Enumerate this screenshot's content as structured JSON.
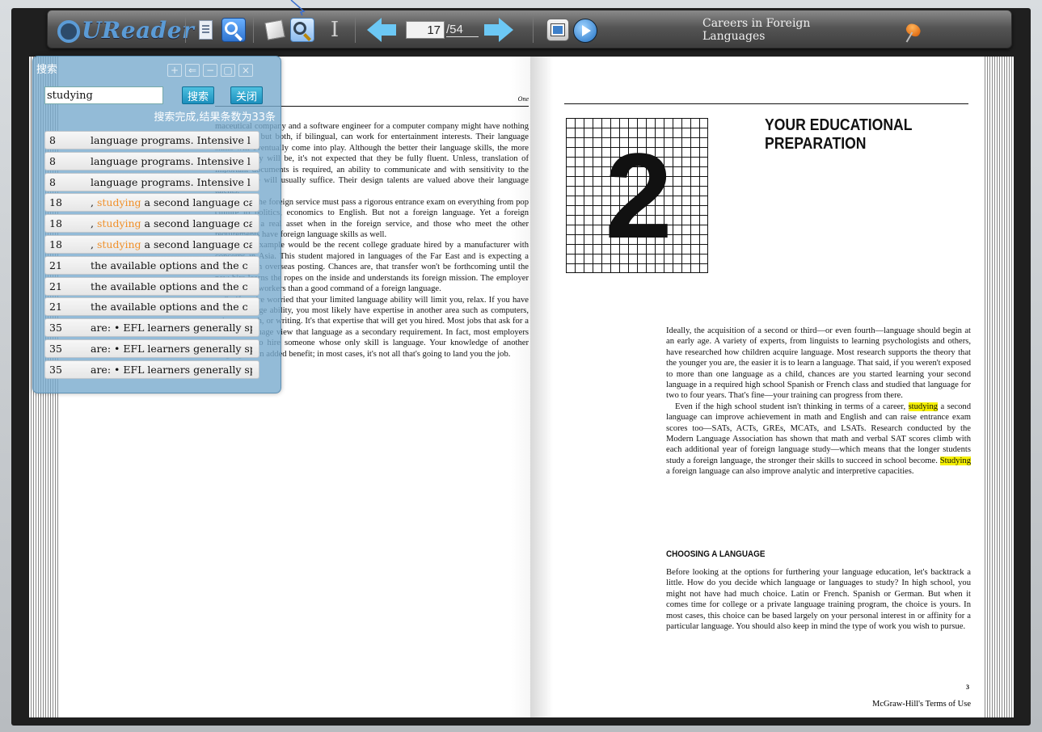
{
  "toolbar": {
    "logo": "UReader",
    "page_current": "17",
    "page_total": "/54",
    "book_title": "Careers in Foreign Languages",
    "icons": [
      "page-view-icon",
      "search-icon",
      "annotate-icon",
      "find-icon",
      "text-select-icon",
      "prev-page-icon",
      "next-page-icon",
      "screenshot-icon",
      "play-icon",
      "pin-icon"
    ]
  },
  "search": {
    "title": "搜索",
    "win_buttons": [
      "+",
      "−",
      "▢",
      "×"
    ],
    "query": "studying",
    "search_button": "搜索",
    "close_button": "关闭",
    "status": "搜索完成,结果条数为33条",
    "keyword_color": "#f0902a",
    "results": [
      {
        "page": "8",
        "pre": "language programs. Intensive l",
        "kw": "",
        "post": ""
      },
      {
        "page": "8",
        "pre": "language programs. Intensive l",
        "kw": "",
        "post": ""
      },
      {
        "page": "8",
        "pre": "language programs. Intensive l",
        "kw": "",
        "post": ""
      },
      {
        "page": "18",
        "pre": ", ",
        "kw": "studying",
        "post": " a second language ca"
      },
      {
        "page": "18",
        "pre": ", ",
        "kw": "studying",
        "post": " a second language ca"
      },
      {
        "page": "18",
        "pre": ", ",
        "kw": "studying",
        "post": " a second language ca"
      },
      {
        "page": "21",
        "pre": "the available options and the c",
        "kw": "",
        "post": ""
      },
      {
        "page": "21",
        "pre": "the available options and the c",
        "kw": "",
        "post": ""
      },
      {
        "page": "21",
        "pre": "the available options and the c",
        "kw": "",
        "post": ""
      },
      {
        "page": "35",
        "pre": "are: • EFL learners generally sp",
        "kw": "",
        "post": ""
      },
      {
        "page": "35",
        "pre": "are: • EFL learners generally sp",
        "kw": "",
        "post": ""
      },
      {
        "page": "35",
        "pre": "are: • EFL learners generally sp",
        "kw": "",
        "post": ""
      }
    ]
  },
  "left_page": {
    "header": "One",
    "paragraphs": [
      "maceutical company and a software engineer for a computer company might have nothing in common, but both, if bilingual, can work for entertainment interests. Their language skills will eventually come into play. Although the better their language skills, the more effective they will be, it's not expected that they be fully fluent. Unless, translation of important documents is required, an ability to communicate and with sensitivity to the other culture will usually suffice. Their design talents are valued above their language talents.",
      "Those in the foreign service must pass a rigorous entrance exam on everything from pop culture to politics, economics to English. But not a foreign language. Yet a foreign language is a real asset when in the foreign service, and those who meet the other requirements have foreign language skills as well.",
      "Another example would be the recent college graduate hired by a manufacturer with concerns in Asia. This student majored in languages of the Far East and is expecting a transfer to an overseas posting. Chances are, that transfer won't be forthcoming until the new hire learns the ropes on the inside and understands its foreign mission. The employer values good workers than a good command of a foreign language.",
      "So if you're worried that your limited language ability will limit you, relax. If you have some language ability, you most likely have expertise in another area such as computers, science, math, or writing. It's that expertise that will get you hired. Most jobs that ask for a foreign language view that language as a secondary requirement. In fact, most employers don't want to hire someone whose only skill is language. Your knowledge of another language is an added benefit; in most cases, it's not all that's going to land you the job."
    ]
  },
  "right_page": {
    "chapter_number": "2",
    "chapter_title": "YOUR EDUCATIONAL PREPARATION",
    "p1": "Ideally, the acquisition of a second or third—or even fourth—language should begin at an early age. A variety of experts, from linguists to learning psychologists and others, have researched how children acquire language. Most research supports the theory that the younger you are, the easier it is to learn a language. That said, if you weren't exposed to more than one language as a child, chances are you started learning your second language in a required high school Spanish or French class and studied that language for two to four years. That's fine—your training can progress from there.",
    "p2_a": "Even if the high school student isn't thinking in terms of a career, ",
    "p2_hl1": "studying",
    "p2_b": " a second language can improve achievement in math and English and can raise entrance exam scores too—SATs, ACTs, GREs, MCATs, and LSATs. Research conducted by the Modern Language Association has shown that math and verbal SAT scores climb with each additional year of foreign language study—which means that the longer students study a foreign language, the stronger their skills to succeed in school become. ",
    "p2_hl2": "Studying",
    "p2_c": " a foreign language can also improve analytic and interpretive capacities.",
    "subheading": "CHOOSING A LANGUAGE",
    "p3": "Before looking at the options for furthering your language education, let's backtrack a little. How do you decide which language or languages to study? In high school, you might not have had much choice. Latin or French. Spanish or German. But when it comes time for college or a private language training program, the choice is yours. In most cases, this choice can be based largely on your personal interest in or affinity for a particular language. You should also keep in mind the type of work you wish to pursue.",
    "page_number": "3",
    "footer": "McGraw-Hill's Terms of Use",
    "highlight_color": "#f5f000"
  }
}
